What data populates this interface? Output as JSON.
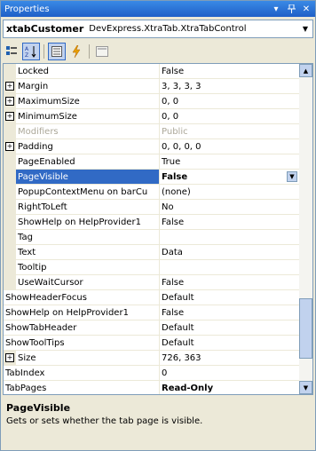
{
  "window": {
    "title": "Properties",
    "dropdown_glyph": "▾",
    "pin_glyph": "ꔅ",
    "close_glyph": "✕"
  },
  "object_selector": {
    "name": "xtabCustomer",
    "type": "DevExpress.XtraTab.XtraTabControl"
  },
  "toolbar": {
    "categorized_icon": "categorized-icon",
    "alphabetical_icon": "alphabetical-icon",
    "properties_icon": "properties-icon",
    "events_icon": "events-icon",
    "property_pages_icon": "property-pages-icon"
  },
  "grid": {
    "rows": [
      {
        "name": "Locked",
        "value": "False",
        "level": "sub"
      },
      {
        "name": "Margin",
        "value": "3, 3, 3, 3",
        "level": "sub",
        "expandable": true
      },
      {
        "name": "MaximumSize",
        "value": "0, 0",
        "level": "sub",
        "expandable": true
      },
      {
        "name": "MinimumSize",
        "value": "0, 0",
        "level": "sub",
        "expandable": true
      },
      {
        "name": "Modifiers",
        "value": "Public",
        "level": "sub",
        "disabled": true
      },
      {
        "name": "Padding",
        "value": "0, 0, 0, 0",
        "level": "sub",
        "expandable": true
      },
      {
        "name": "PageEnabled",
        "value": "True",
        "level": "sub"
      },
      {
        "name": "PageVisible",
        "value": "False",
        "level": "sub",
        "selected": true,
        "bold": true
      },
      {
        "name": "PopupContextMenu on barCu",
        "value": "(none)",
        "level": "sub"
      },
      {
        "name": "RightToLeft",
        "value": "No",
        "level": "sub"
      },
      {
        "name": "ShowHelp on HelpProvider1",
        "value": "False",
        "level": "sub"
      },
      {
        "name": "Tag",
        "value": "",
        "level": "sub"
      },
      {
        "name": "Text",
        "value": "Data",
        "level": "sub"
      },
      {
        "name": "Tooltip",
        "value": "",
        "level": "sub"
      },
      {
        "name": "UseWaitCursor",
        "value": "False",
        "level": "sub"
      },
      {
        "name": "ShowHeaderFocus",
        "value": "Default",
        "level": "top"
      },
      {
        "name": "ShowHelp on HelpProvider1",
        "value": "False",
        "level": "top"
      },
      {
        "name": "ShowTabHeader",
        "value": "Default",
        "level": "top"
      },
      {
        "name": "ShowToolTips",
        "value": "Default",
        "level": "top"
      },
      {
        "name": "Size",
        "value": "726, 363",
        "level": "top",
        "expandable": true
      },
      {
        "name": "TabIndex",
        "value": "0",
        "level": "top"
      },
      {
        "name": "TabPages",
        "value": "Read-Only",
        "level": "top",
        "bold": true
      }
    ]
  },
  "description": {
    "title": "PageVisible",
    "text": "Gets or sets whether the tab page is visible."
  }
}
